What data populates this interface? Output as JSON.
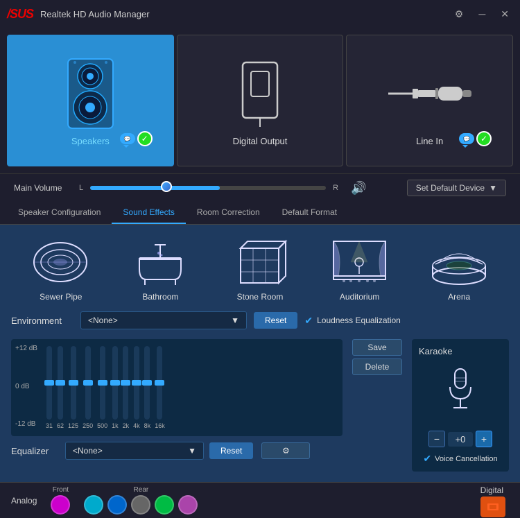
{
  "titlebar": {
    "logo": "/SUS",
    "title": "Realtek HD Audio Manager",
    "gear_icon": "⚙",
    "minimize_icon": "─",
    "close_icon": "✕"
  },
  "devices": [
    {
      "id": "speakers",
      "label": "Speakers",
      "active": true
    },
    {
      "id": "digital-output",
      "label": "Digital Output",
      "active": false
    },
    {
      "id": "line-in",
      "label": "Line In",
      "active": false
    }
  ],
  "volume": {
    "label": "Main Volume",
    "l_label": "L",
    "r_label": "R",
    "value": 55,
    "default_device_label": "Set Default Device"
  },
  "tabs": [
    {
      "id": "speaker-config",
      "label": "Speaker Configuration",
      "active": false
    },
    {
      "id": "sound-effects",
      "label": "Sound Effects",
      "active": true
    },
    {
      "id": "room-correction",
      "label": "Room Correction",
      "active": false
    },
    {
      "id": "default-format",
      "label": "Default Format",
      "active": false
    }
  ],
  "environments": [
    {
      "id": "sewer-pipe",
      "label": "Sewer Pipe"
    },
    {
      "id": "bathroom",
      "label": "Bathroom"
    },
    {
      "id": "stone-room",
      "label": "Stone Room"
    },
    {
      "id": "auditorium",
      "label": "Auditorium"
    },
    {
      "id": "arena",
      "label": "Arena"
    }
  ],
  "environment_control": {
    "label": "Environment",
    "value": "<None>",
    "reset_label": "Reset",
    "loudness_label": "Loudness Equalization",
    "loudness_checked": true
  },
  "equalizer": {
    "label": "Equalizer",
    "value": "<None>",
    "reset_label": "Reset",
    "save_label": "Save",
    "delete_label": "Delete",
    "db_labels": [
      "+12 dB",
      "0 dB",
      "-12 dB"
    ],
    "bands": [
      {
        "hz": "31",
        "pos": 50
      },
      {
        "hz": "62",
        "pos": 50
      },
      {
        "hz": "125",
        "pos": 50
      },
      {
        "hz": "250",
        "pos": 50
      },
      {
        "hz": "500",
        "pos": 50
      },
      {
        "hz": "1k",
        "pos": 50
      },
      {
        "hz": "2k",
        "pos": 50
      },
      {
        "hz": "4k",
        "pos": 50
      },
      {
        "hz": "8k",
        "pos": 50
      },
      {
        "hz": "16k",
        "pos": 50
      }
    ]
  },
  "karaoke": {
    "title": "Karaoke",
    "value": "+0",
    "minus_label": "−",
    "plus_label": "+",
    "voice_cancel_label": "Voice Cancellation",
    "voice_cancel_checked": true
  },
  "bottom_bar": {
    "analog_label": "Analog",
    "front_label": "Front",
    "rear_label": "Rear",
    "digital_label": "Digital",
    "jacks": {
      "front": [
        {
          "color": "#cc00cc"
        }
      ],
      "rear": [
        {
          "color": "#00aacc"
        },
        {
          "color": "#0066cc"
        },
        {
          "color": "#888888"
        },
        {
          "color": "#00bb44"
        },
        {
          "color": "#aa44aa"
        }
      ]
    }
  }
}
